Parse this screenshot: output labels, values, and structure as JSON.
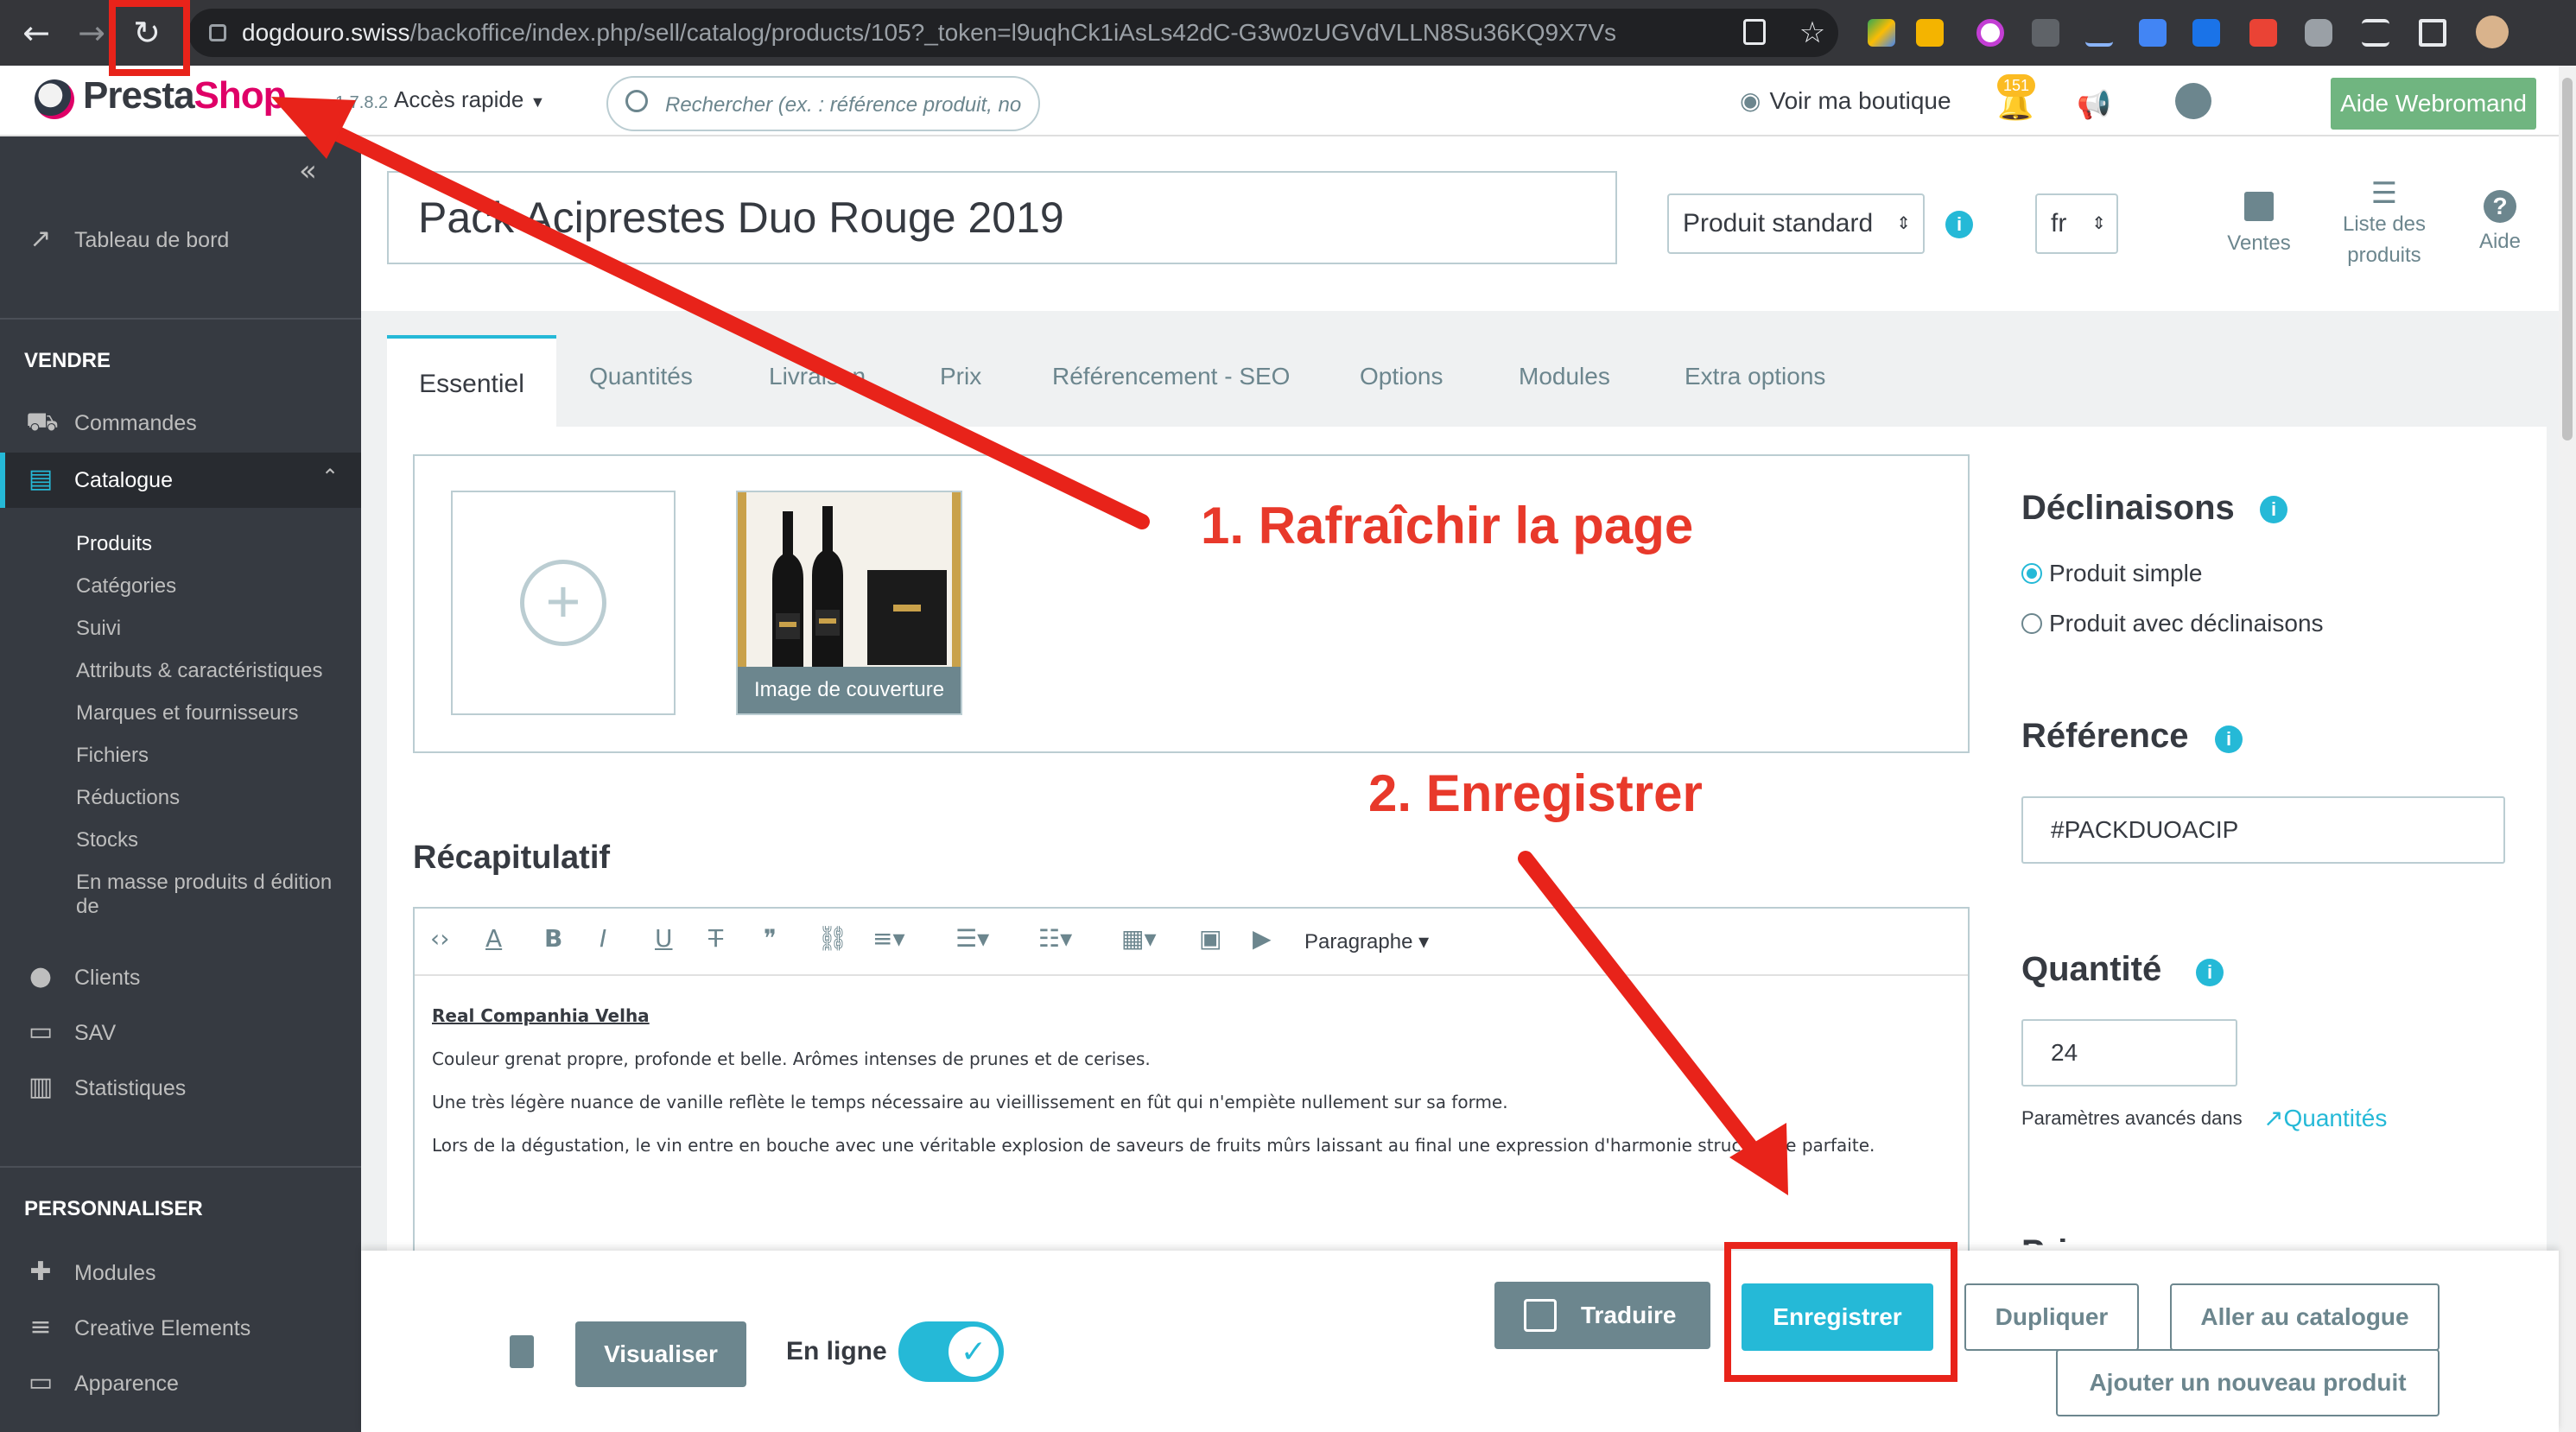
{
  "browser": {
    "url_host": "dogdouro.swiss",
    "url_path": "/backoffice/index.php/sell/catalog/products/105?_token=l9uqhCk1iAsLs42dC-G3w0zUGVdVLLN8Su36KQ9X7Vs"
  },
  "header": {
    "logo_presta": "Presta",
    "logo_shop": "Shop",
    "version": "1.7.8.2",
    "quick_access": "Accès rapide",
    "search_placeholder": "Rechercher (ex. : référence produit, no",
    "view_shop": "Voir ma boutique",
    "notifications_count": "151",
    "help_button": "Aide Webromand"
  },
  "sidebar": {
    "dashboard": "Tableau de bord",
    "section_sell": "VENDRE",
    "orders": "Commandes",
    "catalogue": "Catalogue",
    "catalogue_sub": [
      "Produits",
      "Catégories",
      "Suivi",
      "Attributs & caractéristiques",
      "Marques et fournisseurs",
      "Fichiers",
      "Réductions",
      "Stocks",
      "En masse produits d édition",
      "de"
    ],
    "customers": "Clients",
    "sav": "SAV",
    "stats": "Statistiques",
    "section_customize": "PERSONNALISER",
    "modules": "Modules",
    "creative": "Creative Elements",
    "appearance": "Apparence"
  },
  "product": {
    "name": "Pack Aciprestes Duo Rouge 2019",
    "type": "Produit standard",
    "lang": "fr"
  },
  "head_tools": {
    "sales": "Ventes",
    "product_list_1": "Liste des",
    "product_list_2": "produits",
    "help": "Aide"
  },
  "tabs": [
    "Essentiel",
    "Quantités",
    "Livraison",
    "Prix",
    "Référencement - SEO",
    "Options",
    "Modules",
    "Extra options"
  ],
  "images": {
    "cover_label": "Image de couverture"
  },
  "summary": {
    "title": "Récapitulatif",
    "paragraph_format": "Paragraphe",
    "heading": "Real Companhia Velha",
    "p1": "Couleur grenat propre, profonde et belle. Arômes intenses de prunes et de cerises.",
    "p2": "Une très légère nuance de vanille reflète le temps nécessaire au vieillissement en fût qui n'empiète nullement sur sa forme.",
    "p3": "Lors de la dégustation, le vin entre en bouche avec une véritable explosion de saveurs de fruits mûrs laissant au final une expression d'harmonie structurelle parfaite."
  },
  "right": {
    "variations_title": "Déclinaisons",
    "simple_product": "Produit simple",
    "with_variations": "Produit avec déclinaisons",
    "reference_title": "Référence",
    "reference_value": "#PACKDUOACIP",
    "quantity_title": "Quantité",
    "quantity_value": "24",
    "advanced_params": "Paramètres avancés dans",
    "quantities_link": "Quantités",
    "price_title_partial": "Prix"
  },
  "footer": {
    "preview": "Visualiser",
    "online": "En ligne",
    "translate": "Traduire",
    "save": "Enregistrer",
    "duplicate": "Dupliquer",
    "go_catalog": "Aller au catalogue",
    "add_new": "Ajouter un nouveau produit"
  },
  "annotations": {
    "step1": "1. Rafraîchir la page",
    "step2": "2. Enregistrer"
  },
  "colors": {
    "accent": "#25b9d7",
    "sidebar": "#363a41",
    "help_green": "#70b580",
    "annotation_red": "#e8392b"
  }
}
